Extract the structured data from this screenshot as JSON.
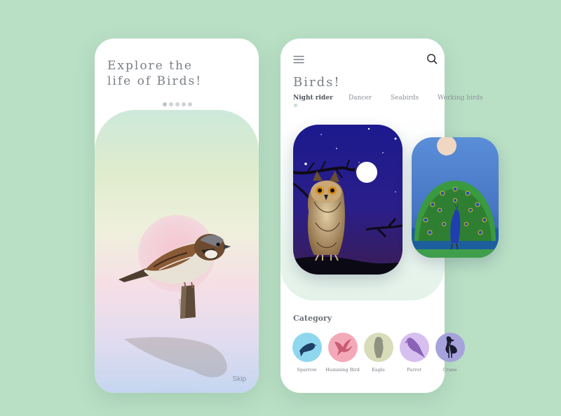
{
  "intro": {
    "title_line1": "Explore the",
    "title_line2": "life of Birds!",
    "skip_label": "Skip",
    "carousel_pages": 5,
    "active_page": 1,
    "next_icon": "arrow-right-icon"
  },
  "home": {
    "title": "Birds!",
    "menu_icon": "menu-icon",
    "search_icon": "search-icon",
    "tabs": [
      {
        "label": "Night rider",
        "active": true
      },
      {
        "label": "Dancer",
        "active": false
      },
      {
        "label": "Seabirds",
        "active": false
      },
      {
        "label": "Working birds",
        "active": false
      }
    ],
    "featured": [
      {
        "name": "owl",
        "icon": "owl-card"
      },
      {
        "name": "peacock",
        "icon": "peacock-card"
      }
    ],
    "category_title": "Category",
    "categories": [
      {
        "label": "Sparrow",
        "color": "#8fd7ee",
        "icon": "sparrow-icon"
      },
      {
        "label": "Humming Bird",
        "color": "#f4a9b9",
        "icon": "hummingbird-icon"
      },
      {
        "label": "Eagle",
        "color": "#d8dcb9",
        "icon": "eagle-icon"
      },
      {
        "label": "Parrot",
        "color": "#d7bff0",
        "icon": "parrot-icon"
      },
      {
        "label": "Crane",
        "color": "#a5a2dc",
        "icon": "crane-icon"
      }
    ]
  },
  "colors": {
    "background": "#b9dfc5",
    "title_text": "#7a7f86",
    "owl_night": "#1c1a8e",
    "peacock_sky": "#5a8ed8"
  }
}
